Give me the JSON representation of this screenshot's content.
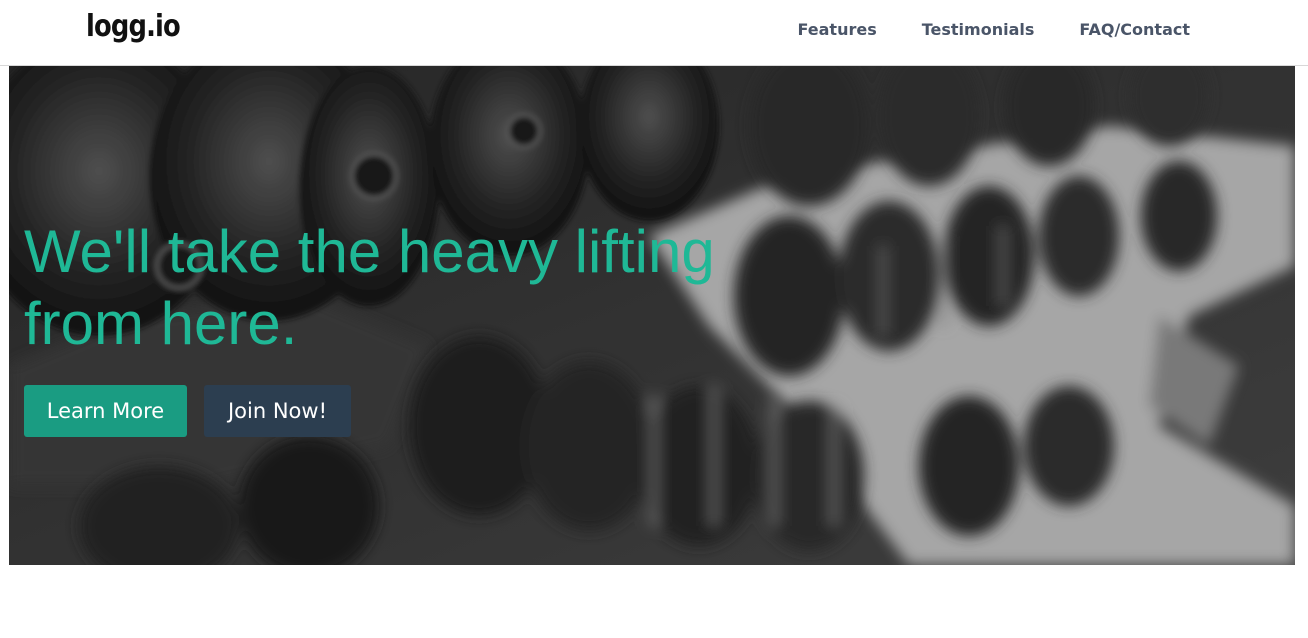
{
  "navbar": {
    "logo": "logg.io",
    "links": [
      "Features",
      "Testimonials",
      "FAQ/Contact"
    ]
  },
  "hero": {
    "headline": "We'll take the heavy lifting from here.",
    "background_image": "blurred grayscale dumbbell rack photo",
    "buttons": {
      "learn_more": "Learn More",
      "join_now": "Join Now!"
    }
  },
  "colors": {
    "accent": "#1fb896",
    "learn_button": "#1a9c82",
    "join_button": "#2c3e50",
    "nav_text": "#4a5568"
  }
}
